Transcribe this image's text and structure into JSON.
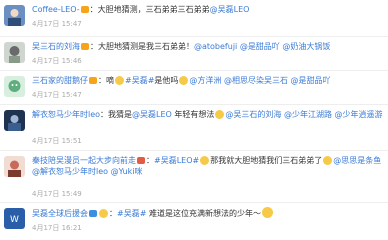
{
  "comments": [
    {
      "username": "Coffee-LEO-",
      "badge": "vip",
      "text_parts": [
        "：大胆地猜测，三石弟弟三石弟弟",
        "@吴磊LEO"
      ],
      "time": "4月17日 15:47",
      "avatar_color": "#6b8fc2"
    },
    {
      "username": "吴三石的刘海",
      "badge": "vip",
      "text_parts": [
        "：大胆地猜测是我三石弟弟！",
        "@atobefuji",
        "@是甜品吖",
        "@奶油大锅饭"
      ],
      "time": "4月17日 15:46",
      "avatar_color": "#8a9a8a"
    },
    {
      "username": "三石家的甜鹅仔",
      "badge": "vip",
      "text_parts": [
        "：嘀",
        "#吴磊#",
        "是他吗",
        "@方洋洲",
        "@相思尽染吴三石",
        "@是甜品吖"
      ],
      "time": "4月17日 15:47",
      "avatar_color": "#5fae7e"
    },
    {
      "username": "解衣恕马少年时leo",
      "badge": "",
      "text_parts": [
        "：我猜是",
        "@吴磊LEO",
        "年轻有想法",
        "@吴三石的刘海",
        "@少年江湖路",
        "@少年逍遥游"
      ],
      "time": "4月17日 15:51",
      "avatar_color": "#3a5f8f"
    },
    {
      "username": "秦技陪吴漫员一起大步向前走",
      "badge": "vip",
      "text_parts": [
        "：",
        "#吴磊LEO#",
        "那我就大胆地猜我们三石弟弟了",
        "@思思是条鱼",
        "@解衣恕马少年时leo",
        "@Yuki咪"
      ],
      "time": "4月17日 15:49",
      "avatar_color": "#c76a5a"
    },
    {
      "username": "吴磊全球后援会",
      "badge": "v-blue",
      "text_parts": [
        "：",
        "#吴磊#",
        "难道是这位充满新想法的少年～"
      ],
      "time": "4月17日 16:21",
      "avatar_color": "#2a5ea8"
    }
  ]
}
